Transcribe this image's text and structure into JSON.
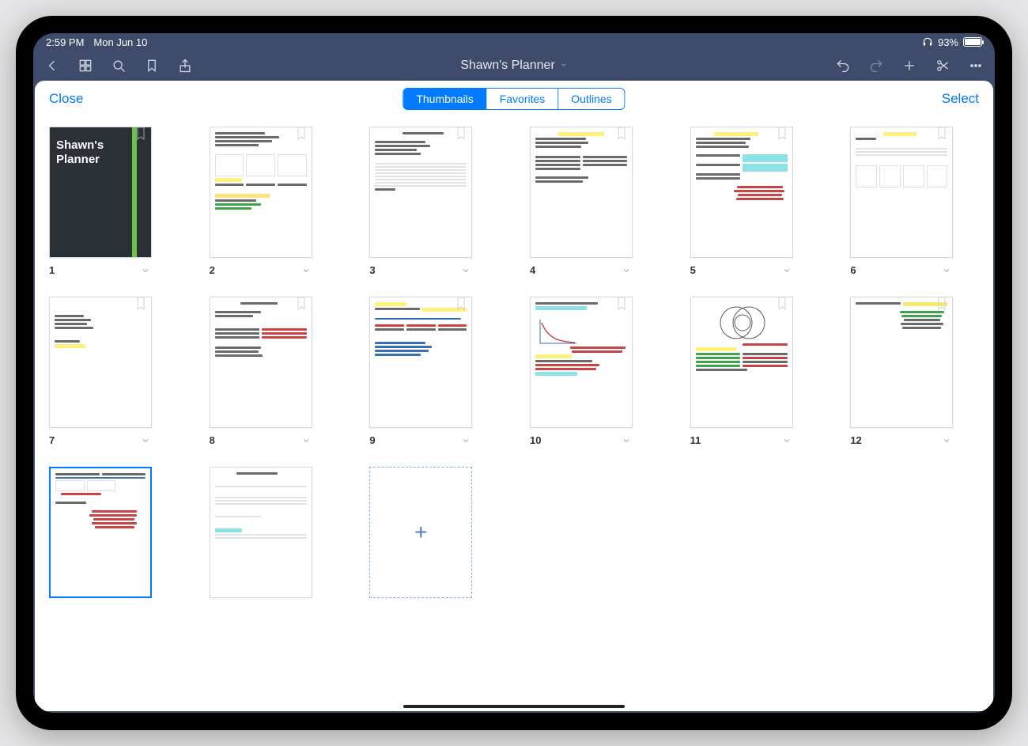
{
  "status": {
    "time": "2:59 PM",
    "date": "Mon Jun 10",
    "battery": "93%"
  },
  "toolbar": {
    "title": "Shawn's Planner"
  },
  "modal": {
    "close": "Close",
    "select": "Select",
    "segments": {
      "thumbnails": "Thumbnails",
      "favorites": "Favorites",
      "outlines": "Outlines"
    }
  },
  "cover": {
    "title_line1": "Shawn's",
    "title_line2": "Planner"
  },
  "pages": [
    {
      "num": "1"
    },
    {
      "num": "2"
    },
    {
      "num": "3"
    },
    {
      "num": "4"
    },
    {
      "num": "5"
    },
    {
      "num": "6"
    },
    {
      "num": "7"
    },
    {
      "num": "8"
    },
    {
      "num": "9"
    },
    {
      "num": "10"
    },
    {
      "num": "11"
    },
    {
      "num": "12"
    }
  ],
  "add_page": "+"
}
